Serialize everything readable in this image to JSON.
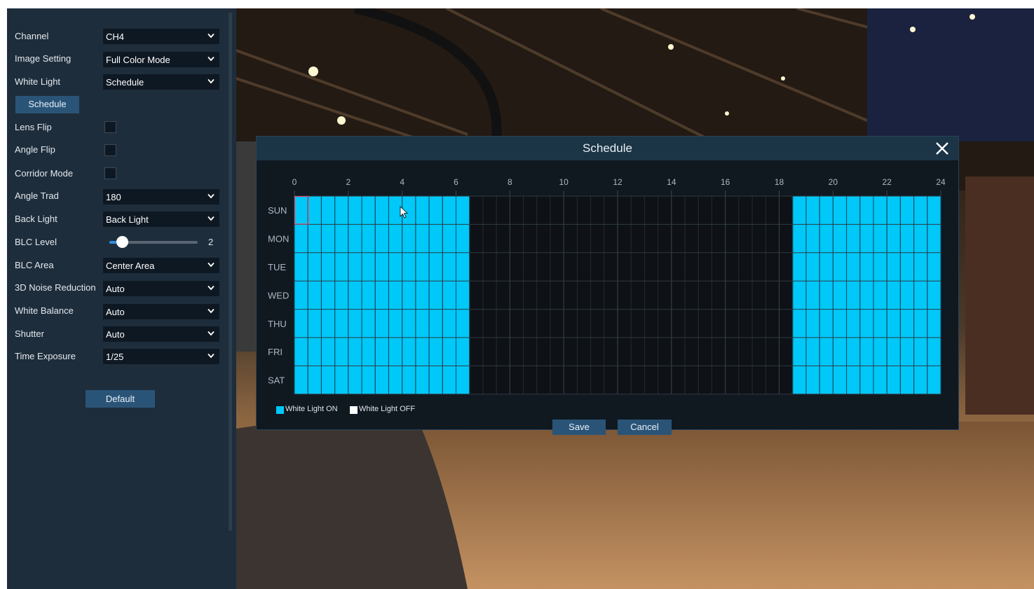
{
  "panel": {
    "rows": [
      {
        "label": "Channel",
        "type": "select",
        "value": "CH4"
      },
      {
        "label": "Image Setting",
        "type": "select",
        "value": "Full Color Mode"
      },
      {
        "label": "White Light",
        "type": "select",
        "value": "Schedule"
      },
      {
        "label": "Lens Flip",
        "type": "checkbox",
        "checked": false
      },
      {
        "label": "Angle Flip",
        "type": "checkbox",
        "checked": false
      },
      {
        "label": "Corridor Mode",
        "type": "checkbox",
        "checked": false
      },
      {
        "label": "Angle Trad",
        "type": "select",
        "value": "180"
      },
      {
        "label": "Back Light",
        "type": "select",
        "value": "Back Light"
      },
      {
        "label": "BLC Level",
        "type": "slider",
        "value": "2"
      },
      {
        "label": "BLC Area",
        "type": "select",
        "value": "Center Area"
      },
      {
        "label": "3D Noise Reduction",
        "type": "select",
        "value": "Auto"
      },
      {
        "label": "White Balance",
        "type": "select",
        "value": "Auto"
      },
      {
        "label": "Shutter",
        "type": "select",
        "value": "Auto"
      },
      {
        "label": "Time Exposure",
        "type": "select",
        "value": "1/25"
      }
    ],
    "schedule_button": "Schedule",
    "default_button": "Default",
    "blc_level_fraction": 0.14
  },
  "dialog": {
    "title": "Schedule",
    "hours": [
      "0",
      "2",
      "4",
      "6",
      "8",
      "10",
      "12",
      "14",
      "16",
      "18",
      "20",
      "22",
      "24"
    ],
    "days": [
      "SUN",
      "MON",
      "TUE",
      "WED",
      "THU",
      "FRI",
      "SAT"
    ],
    "on_ranges_hours": [
      [
        0,
        6.5
      ],
      [
        18.5,
        24
      ]
    ],
    "legend": {
      "on": "White Light ON",
      "off": "White Light OFF"
    },
    "save": "Save",
    "cancel": "Cancel",
    "colors": {
      "on": "#00c8f8",
      "off": "#ffffff",
      "grid_bg": "#0e1115"
    }
  },
  "icons": {
    "close": "close-icon",
    "chevron": "chevron-down-icon",
    "cursor": "mouse-cursor-icon"
  }
}
